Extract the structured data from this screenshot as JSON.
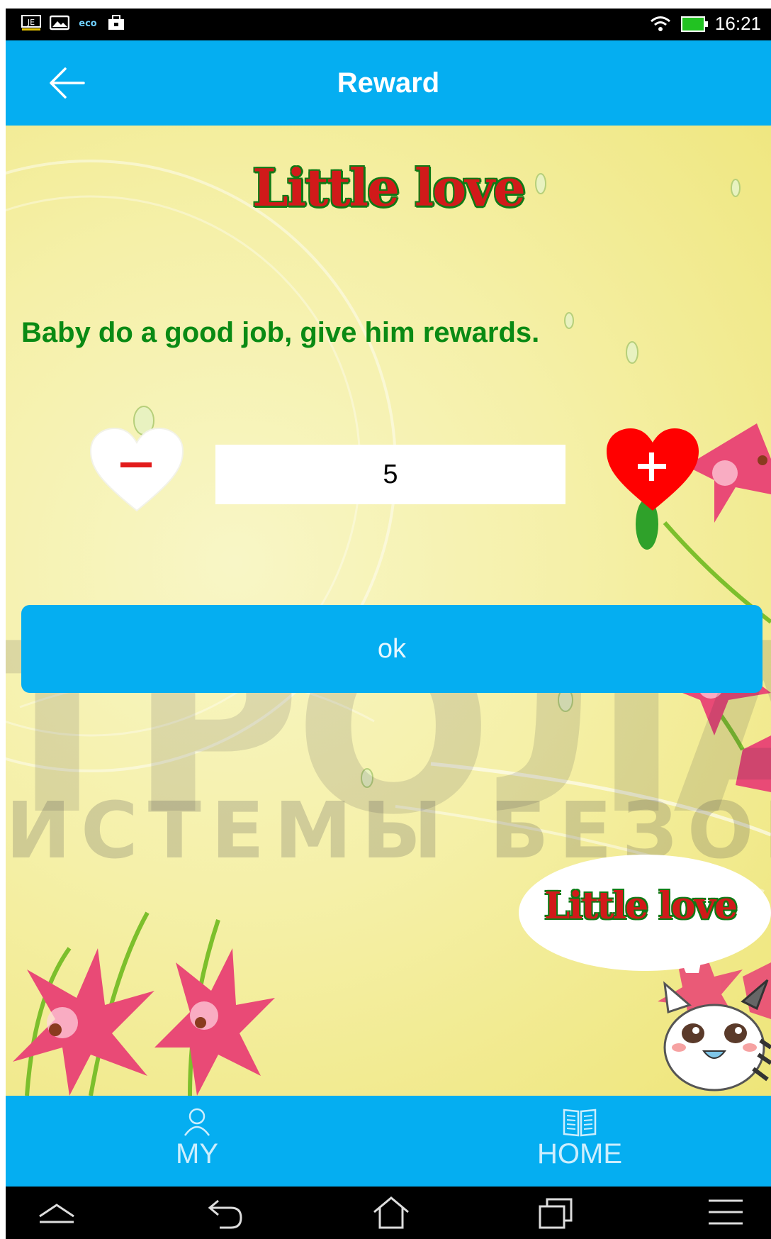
{
  "status_bar": {
    "time": "16:21",
    "left_icons": [
      "keyboard-icon",
      "image-icon",
      "eco-icon",
      "bag-icon"
    ],
    "right_icons": [
      "wifi-icon",
      "battery-icon"
    ]
  },
  "app_bar": {
    "title": "Reward",
    "back_icon": "arrow-left-icon"
  },
  "content": {
    "logo_title": "Little love",
    "instruction": "Baby do a good job, give him rewards.",
    "quantity_value": "5",
    "minus_icon": "heart-minus-icon",
    "plus_icon": "heart-plus-icon",
    "ok_label": "ok",
    "watermark_big": "ТРОЛА",
    "watermark_small": "ИСТЕМЫ БЕЗОПА",
    "bubble_text": "Little love"
  },
  "bottom_nav": {
    "items": [
      {
        "label": "MY",
        "icon": "person-icon"
      },
      {
        "label": "HOME",
        "icon": "book-icon"
      }
    ]
  },
  "system_nav": {
    "icons": [
      "chevron-up-icon",
      "back-icon",
      "home-icon",
      "recent-apps-icon",
      "menu-icon"
    ]
  },
  "colors": {
    "accent_blue": "#05aef1",
    "green_text": "#0a8a14",
    "heart_red": "#ff0000",
    "background_yellow": "#f3ee9c"
  }
}
